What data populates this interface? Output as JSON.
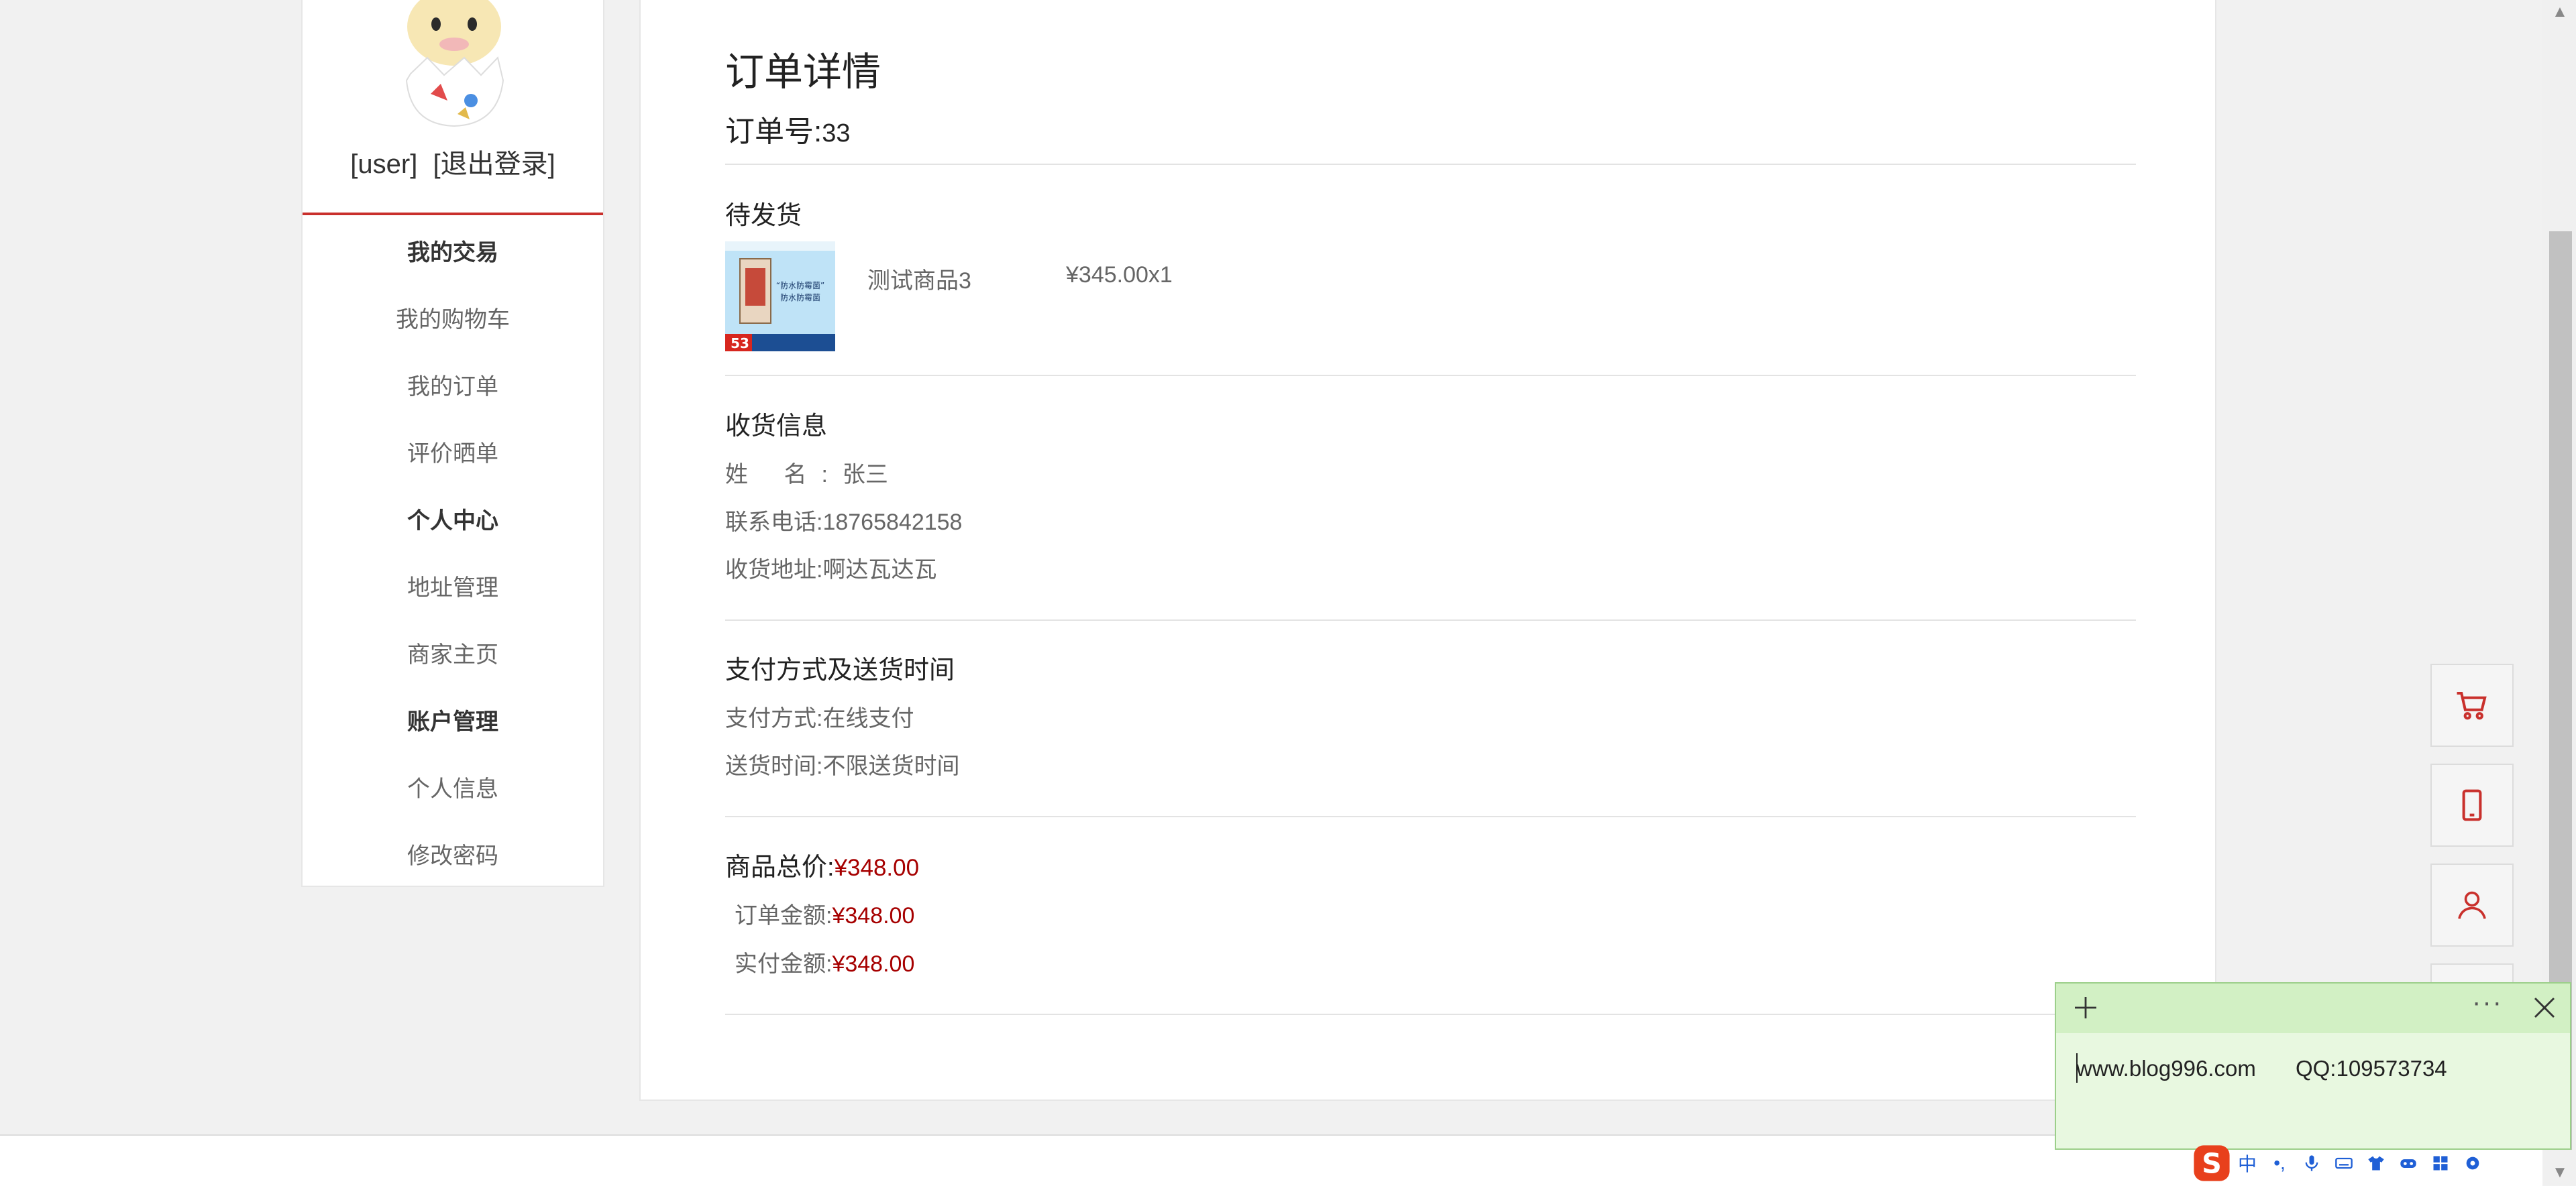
{
  "sidebar": {
    "user_name": "[user]",
    "logout_label": "[退出登录]",
    "menu": [
      {
        "label": "我的交易",
        "heading": true
      },
      {
        "label": "我的购物车",
        "heading": false
      },
      {
        "label": "我的订单",
        "heading": false
      },
      {
        "label": "评价晒单",
        "heading": false
      },
      {
        "label": "个人中心",
        "heading": true
      },
      {
        "label": "地址管理",
        "heading": false
      },
      {
        "label": "商家主页",
        "heading": false
      },
      {
        "label": "账户管理",
        "heading": true
      },
      {
        "label": "个人信息",
        "heading": false
      },
      {
        "label": "修改密码",
        "heading": false
      }
    ]
  },
  "order": {
    "page_title": "订单详情",
    "number_label": "订单号:",
    "number": "33",
    "status": "待发货",
    "item": {
      "name": "测试商品3",
      "price_qty": "¥345.00x1",
      "thumb_text_line1": "“防水防霉菌”",
      "thumb_text_line2": "防水防霉菌",
      "thumb_price": "53"
    },
    "shipping": {
      "section_title": "收货信息",
      "name_label": "姓 名:",
      "name": "张三",
      "phone_label": "联系电话:",
      "phone": "18765842158",
      "address_label": "收货地址:",
      "address": "啊达瓦达瓦"
    },
    "payment": {
      "section_title": "支付方式及送货时间",
      "method_label": "支付方式:",
      "method": "在线支付",
      "time_label": "送货时间:",
      "time": "不限送货时间"
    },
    "totals": {
      "goods_total_label": "商品总价:",
      "goods_total": "¥348.00",
      "order_amount_label": "订单金额:",
      "order_amount": "¥348.00",
      "paid_amount_label": "实付金额:",
      "paid_amount": "¥348.00"
    }
  },
  "floating_buttons": [
    "cart-icon",
    "mobile-icon",
    "user-icon"
  ],
  "note": {
    "text": "www.blog996.com QQ:109573734"
  },
  "ime": {
    "logo_letter": "S",
    "lang": "中",
    "punct": "•,"
  },
  "colors": {
    "accent_red": "#c9302c",
    "price_red": "#a60000",
    "note_bg": "#e8f8e0"
  }
}
